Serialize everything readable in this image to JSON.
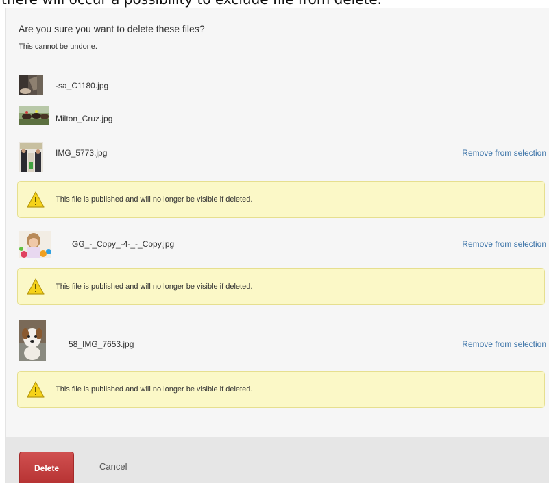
{
  "background_text": "there will occur a possibility to exclude file from delete.",
  "dialog": {
    "heading": "Are you sure you want to delete these files?",
    "subheading": "This cannot be undone.",
    "files": [
      {
        "name": "-sa_C1180.jpg"
      },
      {
        "name": "Milton_Cruz.jpg"
      },
      {
        "name": "IMG_5773.jpg",
        "remove_label": "Remove from selection",
        "warning": "This file is published and will no longer be visible if deleted."
      },
      {
        "name": "GG_-_Copy_-4-_-_Copy.jpg",
        "remove_label": "Remove from selection",
        "warning": "This file is published and will no longer be visible if deleted."
      },
      {
        "name": "58_IMG_7653.jpg",
        "remove_label": "Remove from selection",
        "warning": "This file is published and will no longer be visible if deleted."
      }
    ],
    "footer": {
      "delete_label": "Delete",
      "cancel_label": "Cancel"
    }
  },
  "colors": {
    "link": "#3b73a8",
    "delete_button": "#c04040",
    "warning_bg": "#fbf8c7",
    "dialog_bg": "#f6f6f6"
  },
  "icons": [
    "warning-icon"
  ]
}
